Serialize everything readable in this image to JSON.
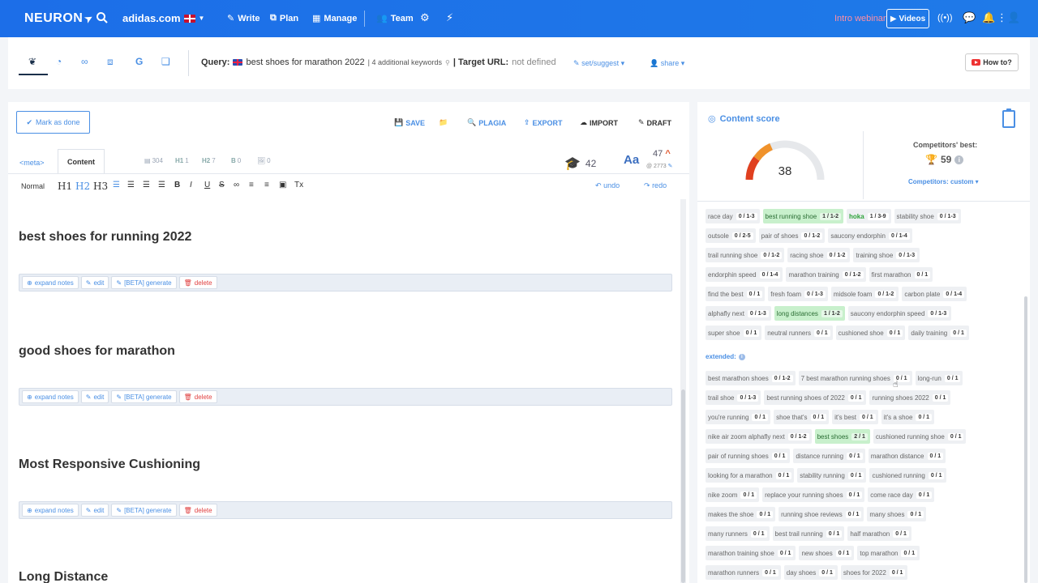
{
  "nav": {
    "logo": "NEURON",
    "site": "adidas.com",
    "items": [
      {
        "label": "Write",
        "icon": "pen-icon"
      },
      {
        "label": "Plan",
        "icon": "hierarchy-icon"
      },
      {
        "label": "Manage",
        "icon": "calendar-icon"
      },
      {
        "label": "Team",
        "icon": "team-icon"
      }
    ],
    "webinar": "Intro webinar",
    "videos": "Videos"
  },
  "toolbar": {
    "query_label": "Query:",
    "query_text": "best shoes for marathon 2022",
    "additional": "| 4 additional keywords",
    "target_label": "| Target URL:",
    "target_value": "not defined",
    "set_suggest": "set/suggest",
    "share": "share",
    "howto": "How to?"
  },
  "editor": {
    "mark_done": "Mark as done",
    "actions": {
      "save": "SAVE",
      "plagia": "PLAGIA",
      "export": "EXPORT",
      "import": "IMPORT",
      "draft": "DRAFT"
    },
    "tabs": {
      "meta": "<meta>",
      "content": "Content"
    },
    "stats": {
      "words": "304",
      "h1_label": "H1",
      "h1": "1",
      "h2_label": "H2",
      "h2": "7",
      "b_label": "B",
      "b": "0",
      "img": "0"
    },
    "grade": "42",
    "aa": "Aa",
    "kw_count": "47",
    "kw_sub": "@ 2773",
    "format": {
      "normal": "Normal",
      "h1": "H1",
      "h2": "H2",
      "h3": "H3",
      "undo": "undo",
      "redo": "redo"
    },
    "note_buttons": {
      "expand": "expand notes",
      "edit": "edit",
      "generate": "[BETA] generate",
      "delete": "delete"
    },
    "headings": [
      "best shoes for running 2022",
      "good shoes for marathon",
      "Most Responsive Cushioning",
      "Long Distance"
    ]
  },
  "score": {
    "title": "Content score",
    "value": "38",
    "competitors_label": "Competitors' best:",
    "competitors_best": "59",
    "competitors_custom": "Competitors: custom",
    "extended_label": "extended:"
  },
  "keywords_basic": [
    [
      {
        "t": "race day",
        "c": "0 / 1-3"
      },
      {
        "t": "best running shoe",
        "c": "1 / 1-2",
        "s": "green"
      },
      {
        "t": "hoka",
        "c": "1 / 3-9",
        "s": "greentxt"
      },
      {
        "t": "stability shoe",
        "c": "0 / 1-3"
      }
    ],
    [
      {
        "t": "outsole",
        "c": "0 / 2-5"
      },
      {
        "t": "pair of shoes",
        "c": "0 / 1-2"
      },
      {
        "t": "saucony endorphin",
        "c": "0 / 1-4"
      }
    ],
    [
      {
        "t": "trail running shoe",
        "c": "0 / 1-2"
      },
      {
        "t": "racing shoe",
        "c": "0 / 1-2"
      },
      {
        "t": "training shoe",
        "c": "0 / 1-3"
      }
    ],
    [
      {
        "t": "endorphin speed",
        "c": "0 / 1-4"
      },
      {
        "t": "marathon training",
        "c": "0 / 1-2"
      },
      {
        "t": "first marathon",
        "c": "0 / 1"
      }
    ],
    [
      {
        "t": "find the best",
        "c": "0 / 1"
      },
      {
        "t": "fresh foam",
        "c": "0 / 1-3"
      },
      {
        "t": "midsole foam",
        "c": "0 / 1-2"
      },
      {
        "t": "carbon plate",
        "c": "0 / 1-4"
      }
    ],
    [
      {
        "t": "alphafly next",
        "c": "0 / 1-3"
      },
      {
        "t": "long distances",
        "c": "1 / 1-2",
        "s": "green"
      },
      {
        "t": "saucony endorphin speed",
        "c": "0 / 1-3"
      }
    ],
    [
      {
        "t": "super shoe",
        "c": "0 / 1"
      },
      {
        "t": "neutral runners",
        "c": "0 / 1"
      },
      {
        "t": "cushioned shoe",
        "c": "0 / 1"
      },
      {
        "t": "daily training",
        "c": "0 / 1"
      }
    ]
  ],
  "keywords_extended": [
    [
      {
        "t": "best marathon shoes",
        "c": "0 / 1-2"
      },
      {
        "t": "7 best marathon running shoes",
        "c": "0 / 1"
      },
      {
        "t": "long-run",
        "c": "0 / 1"
      }
    ],
    [
      {
        "t": "trail shoe",
        "c": "0 / 1-3"
      },
      {
        "t": "best running shoes of 2022",
        "c": "0 / 1"
      },
      {
        "t": "running shoes 2022",
        "c": "0 / 1"
      }
    ],
    [
      {
        "t": "you're running",
        "c": "0 / 1"
      },
      {
        "t": "shoe that's",
        "c": "0 / 1"
      },
      {
        "t": "it's best",
        "c": "0 / 1"
      },
      {
        "t": "it's a shoe",
        "c": "0 / 1"
      }
    ],
    [
      {
        "t": "nike air zoom alphafly next",
        "c": "0 / 1-2"
      },
      {
        "t": "best shoes",
        "c": "2 / 1",
        "s": "green"
      },
      {
        "t": "cushioned running shoe",
        "c": "0 / 1"
      }
    ],
    [
      {
        "t": "pair of running shoes",
        "c": "0 / 1"
      },
      {
        "t": "distance running",
        "c": "0 / 1"
      },
      {
        "t": "marathon distance",
        "c": "0 / 1"
      }
    ],
    [
      {
        "t": "looking for a marathon",
        "c": "0 / 1"
      },
      {
        "t": "stability running",
        "c": "0 / 1"
      },
      {
        "t": "cushioned running",
        "c": "0 / 1"
      }
    ],
    [
      {
        "t": "nike zoom",
        "c": "0 / 1"
      },
      {
        "t": "replace your running shoes",
        "c": "0 / 1"
      },
      {
        "t": "come race day",
        "c": "0 / 1"
      }
    ],
    [
      {
        "t": "makes the shoe",
        "c": "0 / 1"
      },
      {
        "t": "running shoe reviews",
        "c": "0 / 1"
      },
      {
        "t": "many shoes",
        "c": "0 / 1"
      }
    ],
    [
      {
        "t": "many runners",
        "c": "0 / 1"
      },
      {
        "t": "best trail running",
        "c": "0 / 1"
      },
      {
        "t": "half marathon",
        "c": "0 / 1"
      }
    ],
    [
      {
        "t": "marathon training shoe",
        "c": "0 / 1"
      },
      {
        "t": "new shoes",
        "c": "0 / 1"
      },
      {
        "t": "top marathon",
        "c": "0 / 1"
      }
    ],
    [
      {
        "t": "marathon runners",
        "c": "0 / 1"
      },
      {
        "t": "day shoes",
        "c": "0 / 1"
      },
      {
        "t": "shoes for 2022",
        "c": "0 / 1"
      }
    ]
  ]
}
